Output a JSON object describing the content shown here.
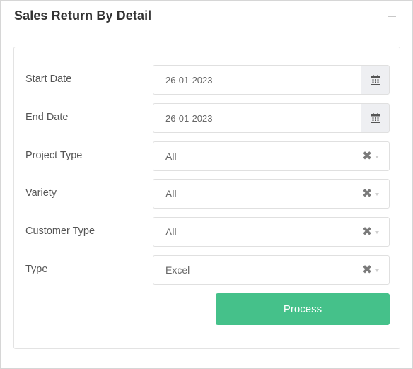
{
  "panel": {
    "title": "Sales Return By Detail"
  },
  "form": {
    "start_date": {
      "label": "Start Date",
      "value": "26-01-2023"
    },
    "end_date": {
      "label": "End Date",
      "value": "26-01-2023"
    },
    "project_type": {
      "label": "Project Type",
      "value": "All"
    },
    "variety": {
      "label": "Variety",
      "value": "All"
    },
    "customer_type": {
      "label": "Customer Type",
      "value": "All"
    },
    "type": {
      "label": "Type",
      "value": "Excel"
    }
  },
  "actions": {
    "process_label": "Process"
  },
  "icons": {
    "calendar": "calendar-icon",
    "clear": "clear-icon",
    "chevron": "chevron-down-icon",
    "collapse": "minus-icon"
  },
  "colors": {
    "accent": "#45c18a",
    "addon_bg": "#eeeff2"
  }
}
